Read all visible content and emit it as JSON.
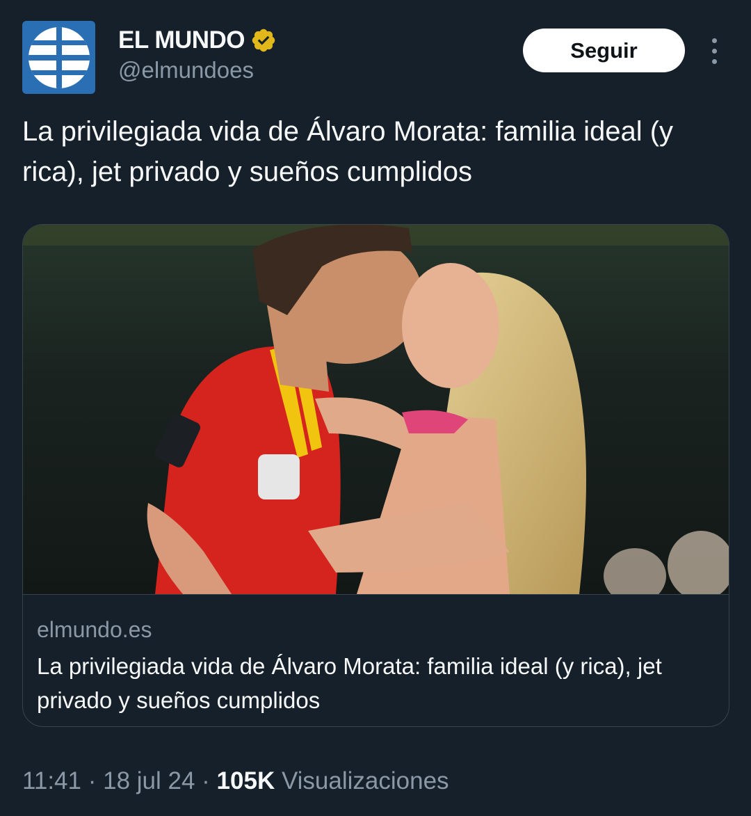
{
  "account": {
    "display_name": "EL MUNDO",
    "handle": "@elmundoes",
    "verified_icon": "verified-badge-gold",
    "avatar_color": "#2a6fb3"
  },
  "actions": {
    "follow_label": "Seguir",
    "more_icon": "more-dots-vertical"
  },
  "tweet": {
    "text": "La privilegiada vida de Álvaro Morata: familia ideal (y rica), jet privado y sueños cumplidos"
  },
  "link_card": {
    "image_alt": "Photo: footballer in red Spain jersey kissing a blonde woman",
    "domain": "elmundo.es",
    "title": "La privilegiada vida de Álvaro Morata: familia ideal (y rica), jet privado y sueños cumplidos"
  },
  "meta": {
    "time": "11:41",
    "separator": " · ",
    "date": "18 jul 24",
    "views_count": "105K",
    "views_label": " Visualizaciones"
  },
  "colors": {
    "background": "#15202b",
    "text_primary": "#f7f9f9",
    "text_secondary": "#8b98a5",
    "border": "#38444d",
    "verified_gold": "#e2b719"
  }
}
